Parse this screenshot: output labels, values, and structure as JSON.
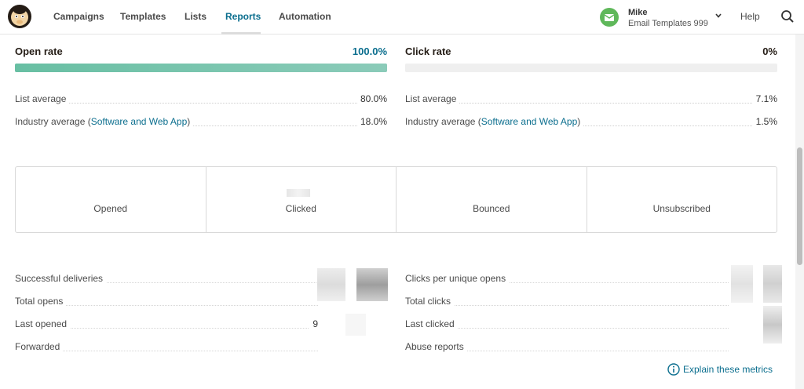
{
  "nav": {
    "items": [
      "Campaigns",
      "Templates",
      "Lists",
      "Reports",
      "Automation"
    ],
    "active": "Reports",
    "help": "Help"
  },
  "user": {
    "name": "Mike",
    "account": "Email Templates 999"
  },
  "open_rate": {
    "label": "Open rate",
    "value": "100.0%",
    "fill_percent": 100,
    "list_average_label": "List average",
    "list_average": "80.0%",
    "industry_label": "Industry average (",
    "industry_link": "Software and Web App",
    "industry_close": ")",
    "industry_average": "18.0%"
  },
  "click_rate": {
    "label": "Click rate",
    "value": "0%",
    "fill_percent": 0,
    "list_average_label": "List average",
    "list_average": "7.1%",
    "industry_label": "Industry average (",
    "industry_link": "Software and Web App",
    "industry_close": ")",
    "industry_average": "1.5%"
  },
  "stats": [
    "Opened",
    "Clicked",
    "Bounced",
    "Unsubscribed"
  ],
  "details_left": [
    {
      "label": "Successful deliveries",
      "value": ""
    },
    {
      "label": "Total opens",
      "value": ""
    },
    {
      "label": "Last opened",
      "value": "9"
    },
    {
      "label": "Forwarded",
      "value": ""
    }
  ],
  "details_right": [
    {
      "label": "Clicks per unique opens",
      "value": ""
    },
    {
      "label": "Total clicks",
      "value": ""
    },
    {
      "label": "Last clicked",
      "value": ""
    },
    {
      "label": "Abuse reports",
      "value": ""
    }
  ],
  "explain_link": "Explain these metrics",
  "colors": {
    "accent": "#0b6e8e",
    "bar_fill": "#68bfa3",
    "avatar": "#5fb85a"
  }
}
